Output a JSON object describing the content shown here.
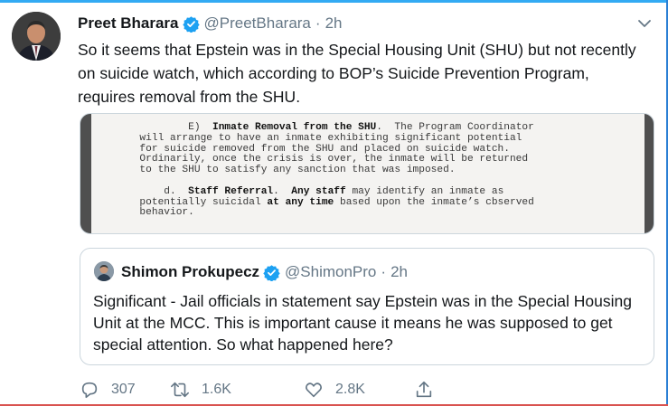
{
  "tweet": {
    "author_name": "Preet Bharara",
    "author_handle": "@PreetBharara",
    "separator": "·",
    "time": "2h",
    "text": "So it seems that Epstein was in the Special Housing Unit (SHU) but not recently on suicide watch, which according to BOP’s Suicide Prevention Program, requires removal from the SHU."
  },
  "document_image": {
    "line1a": "          E)  ",
    "line1b": "Inmate Removal from the SHU",
    "line1c": ".  The Program Coordinator",
    "line2": "  will arrange to have an inmate exhibiting significant potential",
    "line3": "  for suicide removed from the SHU and placed on suicide watch.",
    "line4": "  Ordinarily, once the crisis is over, the inmate will be returned",
    "line5": "  to the SHU to satisfy any sanction that was imposed.",
    "line6a": "      d.  ",
    "line6b": "Staff Referral",
    "line6c": ".  ",
    "line6d": "Any staff",
    "line6e": " may identify an inmate as",
    "line7a": "  potentially suicidal ",
    "line7b": "at any time",
    "line7c": " based upon the inmate’s cbserved",
    "line8": "  behavior."
  },
  "quoted_tweet": {
    "author_name": "Shimon Prokupecz",
    "author_handle": "@ShimonPro",
    "separator": "·",
    "time": "2h",
    "text": "Significant - Jail officials in statement say Epstein was in the  Special Housing Unit at the MCC. This is important cause it means he was supposed to get special attention. So what happened here?"
  },
  "actions": {
    "reply_count": "307",
    "retweet_count": "1.6K",
    "like_count": "2.8K"
  },
  "icons": [
    "verified-badge-icon",
    "chevron-down-icon",
    "reply-icon",
    "retweet-icon",
    "like-icon",
    "share-icon"
  ],
  "colors": {
    "verified": "#1da1f2",
    "secondary_text": "#657786",
    "border": "#ccd6dd"
  }
}
